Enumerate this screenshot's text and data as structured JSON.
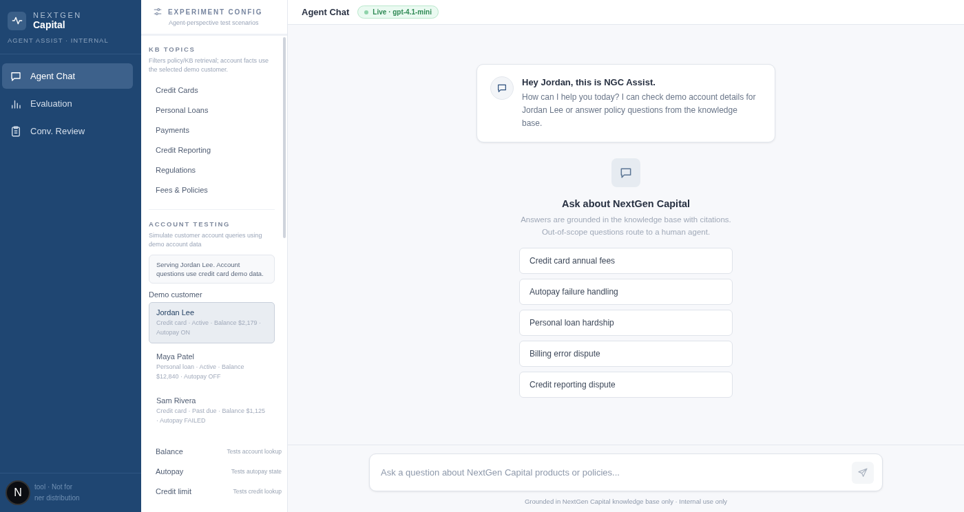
{
  "brand": {
    "eyebrow": "NEXTGEN",
    "name": "Capital",
    "subtitle": "AGENT ASSIST · INTERNAL"
  },
  "nav": [
    {
      "label": "Agent Chat",
      "kind": "chat",
      "selected": true
    },
    {
      "label": "Evaluation",
      "kind": "chart",
      "selected": false
    },
    {
      "label": "Conv. Review",
      "kind": "clipboard",
      "selected": false
    }
  ],
  "sidebar_footer": {
    "badge": "N",
    "lines": [
      "tool · Not for",
      "ner distribution"
    ]
  },
  "config": {
    "title": "EXPERIMENT CONFIG",
    "subtitle": "Agent-perspective test scenarios",
    "kb_topics": {
      "heading": "KB TOPICS",
      "description": "Filters policy/KB retrieval; account facts use the selected demo customer.",
      "items": [
        {
          "label": "Credit Cards",
          "selected": false
        },
        {
          "label": "Personal Loans",
          "selected": false
        },
        {
          "label": "Payments",
          "selected": false
        },
        {
          "label": "Credit Reporting",
          "selected": false
        },
        {
          "label": "Regulations",
          "selected": false
        },
        {
          "label": "Fees & Policies",
          "selected": false
        }
      ]
    },
    "account_testing": {
      "heading": "ACCOUNT TESTING",
      "description": "Simulate customer account queries using demo account data",
      "notice": "Serving Jordan Lee. Account questions use credit card demo data.",
      "customer_label": "Demo customer",
      "customers": [
        {
          "name": "Jordan Lee",
          "details": "Credit card · Active · Balance $2,179 · Autopay ON",
          "selected": true
        },
        {
          "name": "Maya Patel",
          "details": "Personal loan · Active · Balance $12,840 · Autopay OFF",
          "selected": false
        },
        {
          "name": "Sam Rivera",
          "details": "Credit card · Past due · Balance $1,125 · Autopay FAILED",
          "selected": false
        }
      ],
      "queries": [
        {
          "label": "Balance",
          "hint": "Tests account lookup"
        },
        {
          "label": "Autopay",
          "hint": "Tests autopay state"
        },
        {
          "label": "Credit limit",
          "hint": "Tests credit lookup"
        }
      ]
    }
  },
  "header": {
    "title": "Agent Chat",
    "status": "Live · gpt-4.1-mini"
  },
  "greeting": {
    "title": "Hey Jordan, this is NGC Assist.",
    "body": "How can I help you today? I can check demo account details for Jordan Lee or answer policy questions from the knowledge base."
  },
  "empty_state": {
    "title": "Ask about NextGen Capital",
    "lines": [
      "Answers are grounded in the knowledge base with citations.",
      "Out-of-scope questions route to a human agent."
    ]
  },
  "suggestions": [
    "Credit card annual fees",
    "Autopay failure handling",
    "Personal loan hardship",
    "Billing error dispute",
    "Credit reporting dispute"
  ],
  "composer": {
    "placeholder": "Ask a question about NextGen Capital products or policies...",
    "note": "Grounded in NextGen Capital knowledge base only · Internal use only"
  }
}
